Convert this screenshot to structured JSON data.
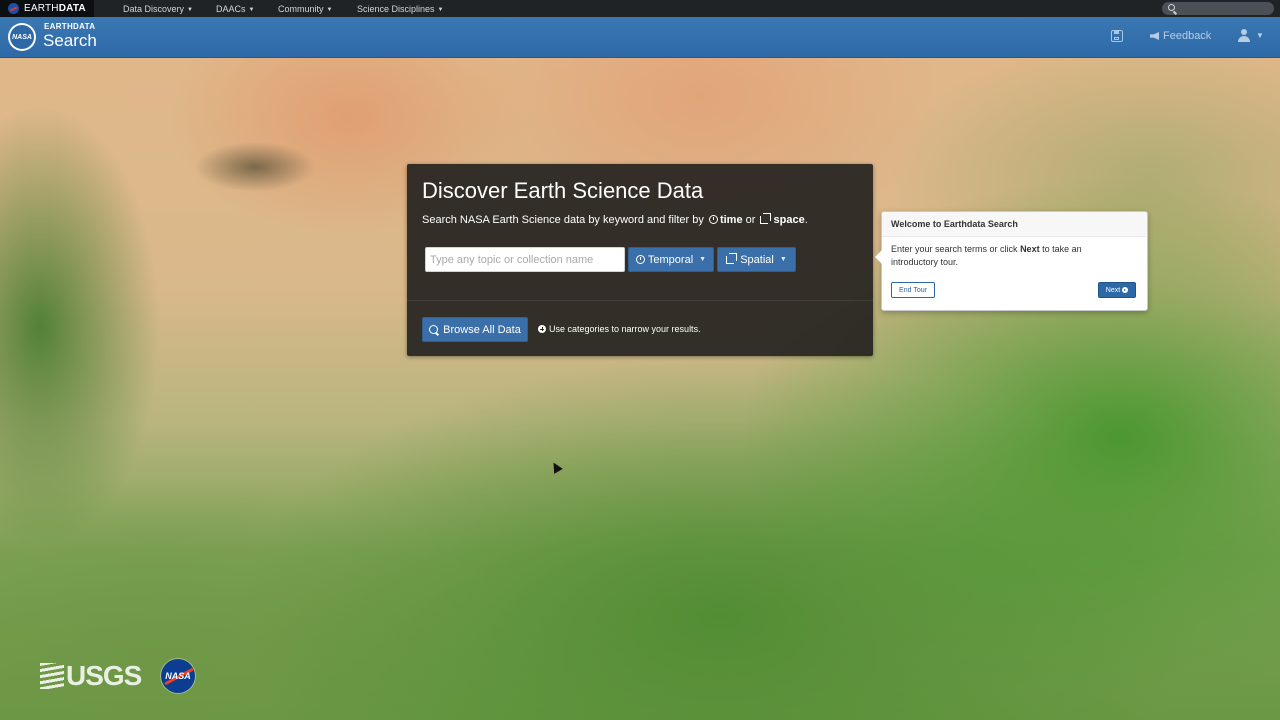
{
  "topbar": {
    "brand_prefix": "EARTH",
    "brand_bold": "DATA",
    "nav": [
      {
        "label": "Data Discovery"
      },
      {
        "label": "DAACs"
      },
      {
        "label": "Community"
      },
      {
        "label": "Science Disciplines"
      }
    ]
  },
  "appbar": {
    "title_small": "EARTHDATA",
    "title_large": "Search",
    "feedback_label": "Feedback",
    "logo_text": "NASA"
  },
  "panel": {
    "heading": "Discover Earth Science Data",
    "subtitle_prefix": "Search NASA Earth Science data by keyword and filter by",
    "subtitle_time": "time",
    "subtitle_or": "or",
    "subtitle_space": "space",
    "subtitle_end": ".",
    "search_placeholder": "Type any topic or collection name",
    "search_value": "",
    "temporal_label": "Temporal",
    "spatial_label": "Spatial",
    "browse_label": "Browse All Data",
    "hint": "Use categories to narrow your results."
  },
  "tour": {
    "title": "Welcome to Earthdata Search",
    "body_prefix": "Enter your search terms or click",
    "body_bold": "Next",
    "body_suffix": "to take an introductory tour.",
    "end_label": "End Tour",
    "next_label": "Next"
  },
  "footer": {
    "usgs": "USGS",
    "nasa": "NASA"
  },
  "colors": {
    "header_blue": "#2d69a6",
    "button_blue": "#3a6fa9",
    "topbar": "#1f2326"
  }
}
